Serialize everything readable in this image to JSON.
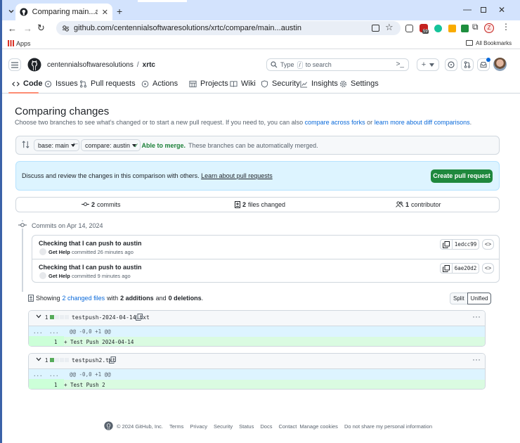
{
  "browser": {
    "tab_title": "Comparing main...austin · centennialsoftwaresolutions/xrtc",
    "url": "github.com/centennialsoftwaresolutions/xrtc/compare/main...austin",
    "apps_label": "Apps",
    "all_bookmarks_label": "All Bookmarks",
    "profile_letter": "Z",
    "ext_badge": "59"
  },
  "header": {
    "owner": "centennialsoftwaresolutions",
    "separator": "/",
    "repo": "xrtc",
    "search_prefix": "Type",
    "search_key": "/",
    "search_suffix": "to search"
  },
  "repo_nav": [
    {
      "label": "Code",
      "icon": "code-icon"
    },
    {
      "label": "Issues",
      "icon": "issue-icon"
    },
    {
      "label": "Pull requests",
      "icon": "pull-request-icon"
    },
    {
      "label": "Actions",
      "icon": "play-icon"
    },
    {
      "label": "Projects",
      "icon": "table-icon"
    },
    {
      "label": "Wiki",
      "icon": "book-icon"
    },
    {
      "label": "Security",
      "icon": "shield-icon"
    },
    {
      "label": "Insights",
      "icon": "graph-icon"
    },
    {
      "label": "Settings",
      "icon": "gear-icon"
    }
  ],
  "compare": {
    "title": "Comparing changes",
    "desc_before": "Choose two branches to see what’s changed or to start a new pull request. If you need to, you can also",
    "link_forks": "compare across forks",
    "desc_or": "or",
    "link_diff": "learn more about diff comparisons",
    "desc_end": ".",
    "base_label": "base: main",
    "compare_label": "compare: austin",
    "merge_bold": "Able to merge.",
    "merge_rest": "These branches can be automatically merged."
  },
  "pr_banner": {
    "text": "Discuss and review the changes in this comparison with others.",
    "link": "Learn about pull requests",
    "button": "Create pull request"
  },
  "stats": {
    "commits_num": "2",
    "commits_label": "commits",
    "files_num": "2",
    "files_label": "files changed",
    "contrib_num": "1",
    "contrib_label": "contributor"
  },
  "commits": {
    "date_heading": "Commits on Apr 14, 2024",
    "items": [
      {
        "title": "Checking that I can push to austin",
        "author": "Get Help",
        "meta": "committed 26 minutes ago",
        "sha": "1edcc99"
      },
      {
        "title": "Checking that I can push to austin",
        "author": "Get Help",
        "meta": "committed 9 minutes ago",
        "sha": "6ae20d2"
      }
    ]
  },
  "diff_summary": {
    "showing": "Showing",
    "files_link": "2 changed files",
    "with": "with",
    "additions": "2 additions",
    "and": "and",
    "deletions": "0 deletions",
    "end": ".",
    "split": "Split",
    "unified": "Unified"
  },
  "files": [
    {
      "count": "1",
      "name": "testpush-2024-04-14.txt",
      "hunk_dots_left": "...",
      "hunk_dots_right": "...",
      "hunk": "@@ -0,0 +1 @@",
      "line_num": "1",
      "line": "+ Test Push 2024-04-14"
    },
    {
      "count": "1",
      "name": "testpush2.txt",
      "hunk_dots_left": "...",
      "hunk_dots_right": "...",
      "hunk": "@@ -0,0 +1 @@",
      "line_num": "1",
      "line": "+ Test Push 2"
    }
  ],
  "footer": {
    "copyright": "© 2024 GitHub, Inc.",
    "links": [
      "Terms",
      "Privacy",
      "Security",
      "Status",
      "Docs",
      "Contact",
      "Manage cookies",
      "Do not share my personal information"
    ]
  },
  "colors": {
    "accent": "#0969da",
    "create_pr": "#1f883d",
    "nav_active_underline": "#fd8c73",
    "frame_blue": "#3b62a8",
    "tab_strip": "#d3e3fd"
  }
}
